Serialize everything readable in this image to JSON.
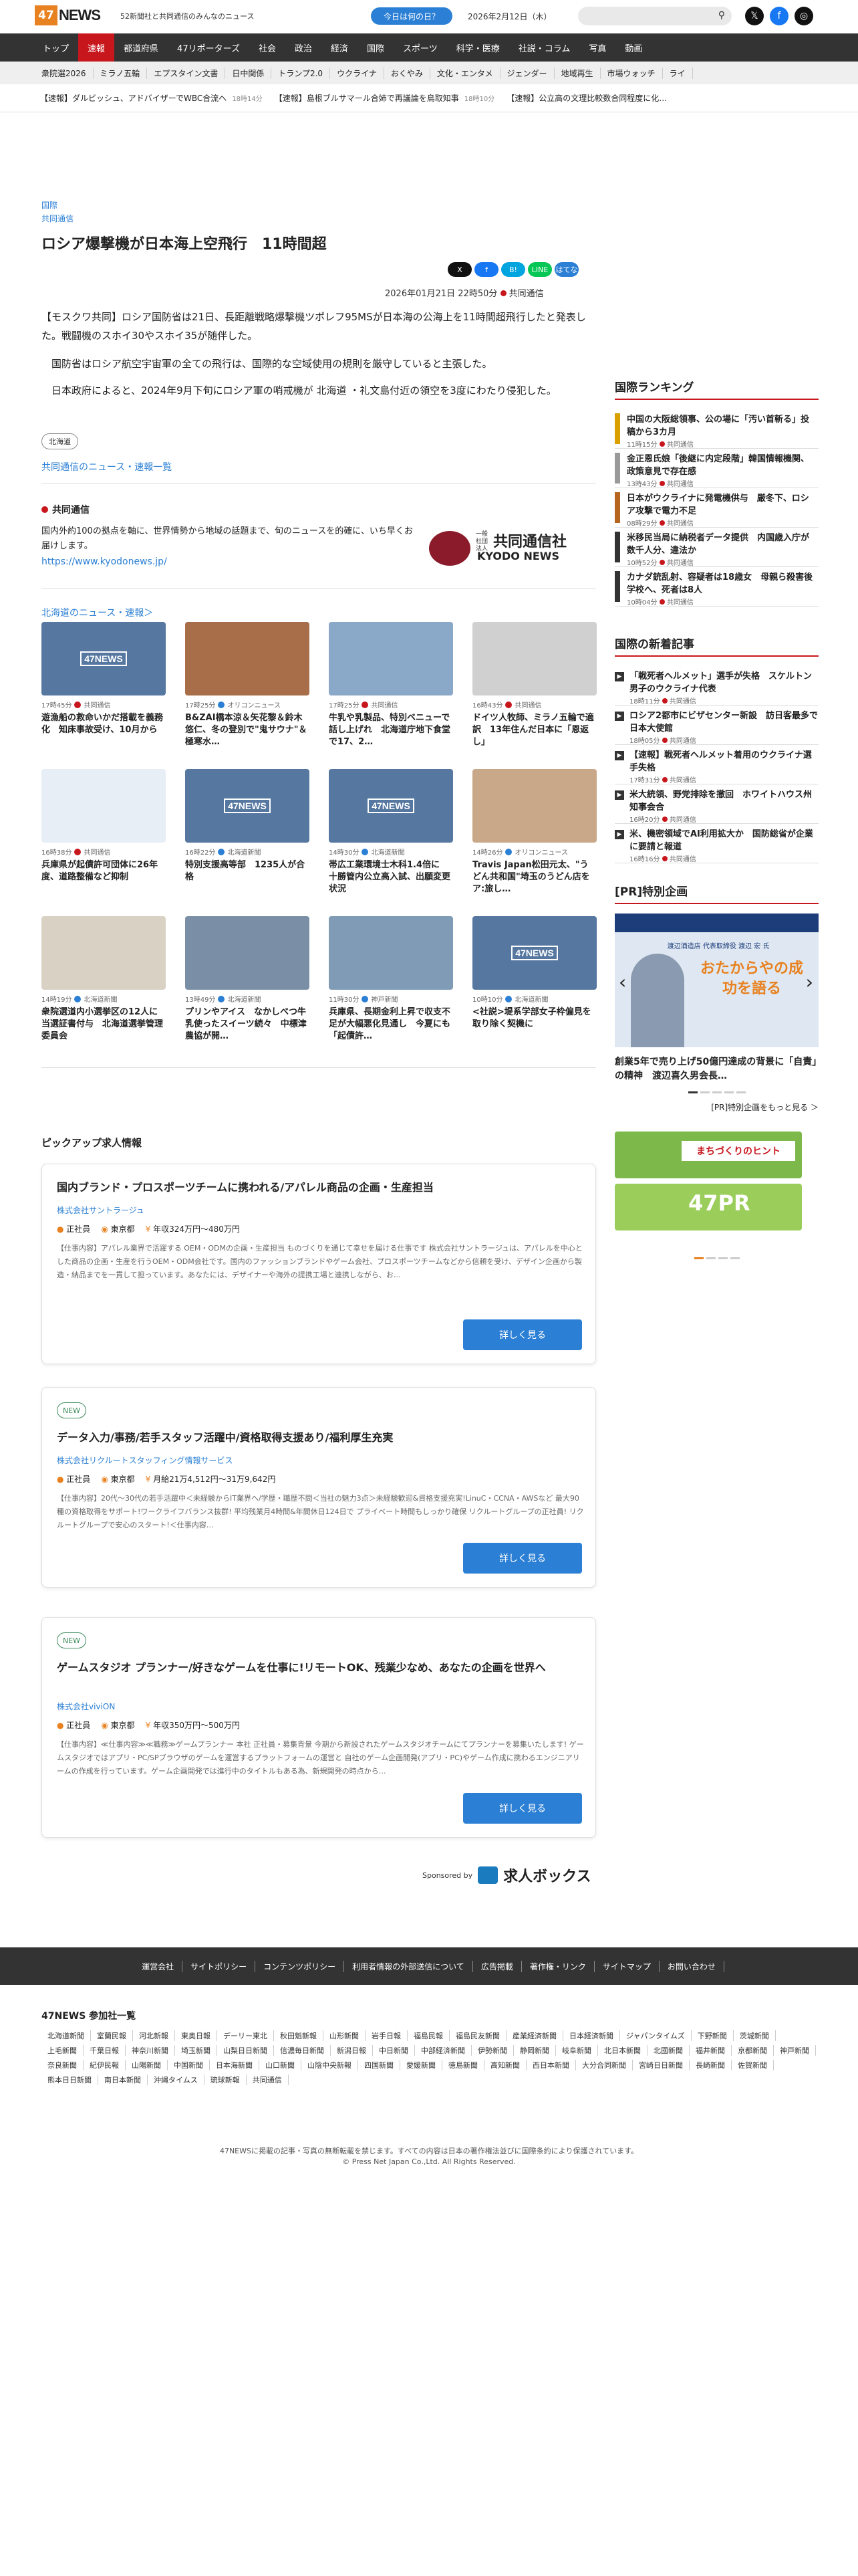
{
  "header": {
    "logo_mark": "47",
    "logo_text": "NEWS",
    "tagline": "52新聞社と共同通信のみんなのニュース",
    "today_button": "今日は何の日？",
    "date": "2026年2月12日（木）",
    "colors": {
      "accent": "#c8161d",
      "brand": "#e8811f",
      "link": "#2b7fd4"
    }
  },
  "nav": [
    "トップ",
    "速報",
    "都道府県",
    "47リポーターズ",
    "社会",
    "政治",
    "経済",
    "国際",
    "スポーツ",
    "科学・医療",
    "社説・コラム",
    "写真",
    "動画"
  ],
  "subnav": [
    "衆院選2026",
    "ミラノ五輪",
    "エプスタイン文書",
    "日中関係",
    "トランプ2.0",
    "ウクライナ",
    "おくやみ",
    "文化・エンタメ",
    "ジェンダー",
    "地域再生",
    "市場ウォッチ",
    "ライ"
  ],
  "ticker": [
    {
      "text": "【速報】ダルビッシュ、アドバイザーでWBC合流へ",
      "time": "18時14分"
    },
    {
      "text": "【速報】島根ブルサマール合姉で再議論を鳥取知事",
      "time": "18時10分"
    },
    {
      "text": "【速報】公立高の文理比較数合同程度に化…",
      "time": ""
    }
  ],
  "article": {
    "section": "国際",
    "source": "共同通信",
    "title": "ロシア爆撃機が日本海上空飛行　11時間超",
    "published": "2026年01月21日 22時50分",
    "pub_source": "共同通信",
    "share": [
      "X",
      "f",
      "B!",
      "LINE",
      "はてな"
    ],
    "paragraphs": [
      "【モスクワ共同】ロシア国防省は21日、長距離戦略爆撃機ツポレフ95MSが日本海の公海上を11時間超飛行したと発表した。戦闘機のスホイ30やスホイ35が随伴した。",
      "国防省はロシア航空宇宙軍の全ての飛行は、国際的な空域使用の規則を厳守していると主張した。",
      "日本政府によると、2024年9月下旬にロシア軍の哨戒機が 北海道 ・礼文島付近の領空を3度にわたり侵犯した。"
    ],
    "tag": "北海道",
    "more_link": "共同通信のニュース・速報一覧"
  },
  "source_box": {
    "name": "共同通信",
    "desc": "国内外約100の拠点を軸に、世界情勢から地域の話題まで、旬のニュースを的確に、いち早くお届けします。",
    "url": "https://www.kyodonews.jp/",
    "logo_small": "一般社団法人",
    "logo_main": "共同通信社",
    "logo_en": "KYODO NEWS"
  },
  "grid": {
    "heading": "北海道のニュース・速報＞",
    "items": [
      {
        "time": "17時45分",
        "src": "共同通信",
        "title": "遊漁船の救命いかだ搭載を義務化　知床事故受け、10月から",
        "img": "news"
      },
      {
        "time": "17時25分",
        "src": "オリコンニュース",
        "title": "B&ZAI橋本涼＆矢花黎＆鈴木悠仁、冬の登別で\"鬼サウナ\"＆極寒水…",
        "img": "sauna"
      },
      {
        "time": "17時25分",
        "src": "共同通信",
        "title": "牛乳や乳製品、特別ベニューで話し上げれ　北海道庁地下食堂で17、2…",
        "img": "building"
      },
      {
        "time": "16時43分",
        "src": "共同通信",
        "title": "ドイツ人牧師、ミラノ五輪で適訳　13年住んだ日本に「恩返し」",
        "img": "gray"
      },
      {
        "time": "16時38分",
        "src": "共同通信",
        "title": "兵庫県が起債許可団体に26年度、道路整備など抑制",
        "img": "office"
      },
      {
        "time": "16時22分",
        "src": "北海道新聞",
        "title": "特別支援高等部　1235人が合格",
        "img": "news"
      },
      {
        "time": "14時30分",
        "src": "北海道新聞",
        "title": "帯広工業環境士木科1.4倍に　十勝管内公立高入試、出願変更状況",
        "img": "news"
      },
      {
        "time": "14時26分",
        "src": "オリコンニュース",
        "title": "Travis Japan松田元太、\"うどん共和国\"埼玉のうどん店をア:旅し…",
        "img": "person"
      },
      {
        "time": "14時19分",
        "src": "北海道新聞",
        "title": "衆院選道内小選挙区の12人に当選証書付与　北海道選挙管理委員会",
        "img": "ceremony"
      },
      {
        "time": "13時49分",
        "src": "北海道新聞",
        "title": "プリンやアイス　なかしべつ牛乳使ったスイーツ続々　中標津農協が開…",
        "img": "cups"
      },
      {
        "time": "11時30分",
        "src": "神戸新聞",
        "title": "兵庫県、長期金利上昇で収支不足が大幅悪化見通し　今夏にも「起債許…",
        "img": "tower"
      },
      {
        "time": "10時10分",
        "src": "北海道新聞",
        "title": "<社説>堤系学部女子枠偏見を取り除く契機に",
        "img": "news"
      }
    ]
  },
  "jobs": {
    "heading": "ピックアップ求人情報",
    "sponsor_label": "Sponsored by",
    "sponsor_name": "求人ボックス",
    "items": [
      {
        "new": "",
        "title": "国内ブランド・プロスポーツチームに携われる/アパレル商品の企画・生産担当",
        "company": "株式会社サントラージュ",
        "type": "正社員",
        "location": "東京都",
        "salary": "年収324万円〜480万円",
        "desc": "【仕事内容】アパレル業界で活躍する OEM・ODMの企画・生産担当 ものづくりを通じて幸せを届ける仕事です 株式会社サントラージュは、アパレルを中心とした商品の企画・生産を行うOEM・ODM会社です。国内のファッションブランドやゲーム会社、プロスポーツチームなどから信頼を受け、デザイン企画から製造・納品までを一貫して担っています。あなたには、デザイナーや海外の提携工場と連携しながら、お…",
        "button": "詳しく見る"
      },
      {
        "new": "NEW",
        "title": "データ入力/事務/若手スタッフ活躍中/資格取得支援あり/福利厚生充実",
        "company": "株式会社リクルートスタッフィング情報サービス",
        "type": "正社員",
        "location": "東京都",
        "salary": "月給21万4,512円〜31万9,642円",
        "desc": "【仕事内容】20代〜30代の若手活躍中＜未経験からIT業界へ/学歴・職歴不問＜当社の魅力3点＞未経験歓迎&資格支援充実!LinuC・CCNA・AWSなど 最大90種の資格取得をサポート!ワークライフバランス抜群! 平均残業月4時間&年間休日124日で プライベート時間もしっかり確保 リクルートグループの正社員! リクルートグループで安心のスタート!＜仕事内容…",
        "button": "詳しく見る"
      },
      {
        "new": "NEW",
        "title": "ゲームスタジオ プランナー/好きなゲームを仕事に!リモートOK、残業少なめ、あなたの企画を世界へ",
        "company": "株式会社viviON",
        "type": "正社員",
        "location": "東京都",
        "salary": "年収350万円〜500万円",
        "desc": "【仕事内容】≪仕事内容≫≪職務≫ゲームプランナー 本社 正社員・募集背景 今期から新設されたゲームスタジオチームにてプランナーを募集いたします! ゲームスタジオではアプリ・PC/SPブラウザのゲームを運営するプラットフォームの運営と 自社のゲーム企画開発(アプリ・PC)やゲーム作成に携わるエンジニアリームの作成を行っています。ゲーム企画開発では進行中のタイトルもある為、新規開発の時点から…",
        "button": "詳しく見る"
      }
    ]
  },
  "sidebar": {
    "ranking_title": "国際ランキング",
    "ranking": [
      {
        "title": "中国の大阪総領事、公の場に「汚い首斬る」投稿から3カ月",
        "time": "11時15分",
        "src": "共同通信",
        "color": "#d9a000"
      },
      {
        "title": "金正恩氏娘「後継に内定段階」韓国情報機関、政策意見で存在感",
        "time": "13時43分",
        "src": "共同通信",
        "color": "#9a9a9a"
      },
      {
        "title": "日本がウクライナに発電機供与　厳冬下、ロシア攻撃で電力不足",
        "time": "08時29分",
        "src": "共同通信",
        "color": "#b5651d"
      },
      {
        "title": "米移民当局に納税者データ提供　内国歳入庁が数千人分、違法か",
        "time": "10時52分",
        "src": "共同通信",
        "color": "#333"
      },
      {
        "title": "カナダ銃乱射、容疑者は18歳女　母親ら殺害後学校へ、死者は8人",
        "time": "10時04分",
        "src": "共同通信",
        "color": "#333"
      }
    ],
    "latest_title": "国際の新着記事",
    "latest": [
      {
        "title": "「戦死者ヘルメット」選手が失格　スケルトン男子のウクライナ代表",
        "time": "18時11分",
        "src": "共同通信"
      },
      {
        "title": "ロシア2都市にビザセンター新設　訪日客最多で日本大使館",
        "time": "18時05分",
        "src": "共同通信"
      },
      {
        "title": "【速報】戦死者ヘルメット着用のウクライナ選手失格",
        "time": "17時31分",
        "src": "共同通信"
      },
      {
        "title": "米大統領、野党排除を撤回　ホワイトハウス州知事会合",
        "time": "16時20分",
        "src": "共同通信"
      },
      {
        "title": "米、機密領域でAI利用拡大か　国防総省が企業に要請と報道",
        "time": "16時16分",
        "src": "共同通信"
      }
    ],
    "pr_title": "[PR]特別企画",
    "pr_banner_small": "渡辺酒造店 代表取締役 渡辺 宏 氏",
    "pr_banner_main": "おたからやの成功を語る",
    "pr_caption": "創業5年で売り上げ50億円達成の背景に「自責」の精神　渡辺喜久男会長…",
    "pr_more": "[PR]特別企画をもっと見る ＞",
    "banner1": "まちづくりのヒント",
    "banner2": "47PR"
  },
  "footer": {
    "links": [
      "運営会社",
      "サイトポリシー",
      "コンテンツポリシー",
      "利用者情報の外部送信について",
      "広告掲載",
      "著作権・リンク",
      "サイトマップ",
      "お問い合わせ"
    ],
    "members_title": "47NEWS 参加社一覧",
    "members": [
      "北海道新聞",
      "室蘭民報",
      "河北新報",
      "東奥日報",
      "デーリー東北",
      "秋田魁新報",
      "山形新聞",
      "岩手日報",
      "福島民報",
      "福島民友新聞",
      "産業経済新聞",
      "日本経済新聞",
      "ジャパンタイムズ",
      "下野新聞",
      "茨城新聞",
      "上毛新聞",
      "千葉日報",
      "神奈川新聞",
      "埼玉新聞",
      "山梨日日新聞",
      "信濃毎日新聞",
      "新潟日報",
      "中日新聞",
      "中部経済新聞",
      "伊勢新聞",
      "静岡新聞",
      "岐阜新聞",
      "北日本新聞",
      "北國新聞",
      "福井新聞",
      "京都新聞",
      "神戸新聞",
      "奈良新聞",
      "紀伊民報",
      "山陽新聞",
      "中国新聞",
      "日本海新聞",
      "山口新聞",
      "山陰中央新報",
      "四国新聞",
      "愛媛新聞",
      "徳島新聞",
      "高知新聞",
      "西日本新聞",
      "大分合同新聞",
      "宮崎日日新聞",
      "長崎新聞",
      "佐賀新聞",
      "熊本日日新聞",
      "南日本新聞",
      "沖縄タイムス",
      "琉球新報",
      "共同通信"
    ],
    "copy1": "47NEWSに掲載の記事・写真の無断転載を禁じます。すべての内容は日本の著作権法並びに国際条約により保護されています。",
    "copy2": "© Press Net Japan Co.,Ltd. All Rights Reserved."
  }
}
